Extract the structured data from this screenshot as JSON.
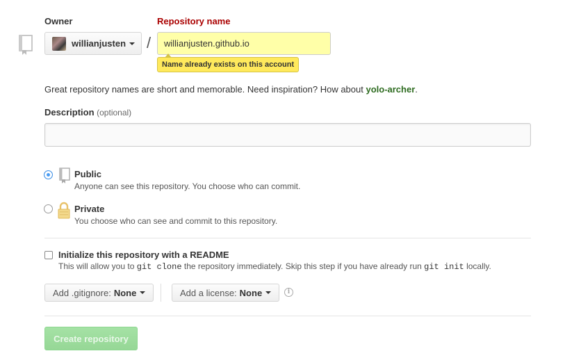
{
  "owner": {
    "label": "Owner",
    "name": "willianjusten"
  },
  "separator": "/",
  "repo_name": {
    "label": "Repository name",
    "value": "willianjusten.github.io",
    "error": "Name already exists on this account"
  },
  "hint": {
    "text": "Great repository names are short and memorable. Need inspiration? How about ",
    "suggestion": "yolo-archer",
    "end": "."
  },
  "description": {
    "label": "Description",
    "optional": "(optional)",
    "value": ""
  },
  "visibility": {
    "selected": "public",
    "public": {
      "title": "Public",
      "desc": "Anyone can see this repository. You choose who can commit."
    },
    "private": {
      "title": "Private",
      "desc": "You choose who can see and commit to this repository."
    }
  },
  "readme": {
    "title": "Initialize this repository with a README",
    "desc_a": "This will allow you to ",
    "code_a": "git clone",
    "desc_b": " the repository immediately. Skip this step if you have already run ",
    "code_b": "git init",
    "desc_c": " locally.",
    "checked": false
  },
  "gitignore": {
    "label": "Add .gitignore:",
    "value": "None"
  },
  "license": {
    "label": "Add a license:",
    "value": "None"
  },
  "info_icon": "i",
  "create_button": "Create repository",
  "colors": {
    "error_label": "#aa0000",
    "input_error_bg": "#ffffa8",
    "tooltip_bg": "#ffe95c",
    "suggestion": "#2d6b1f",
    "create_disabled": "#96d796",
    "radio_on": "#4a9df5"
  }
}
